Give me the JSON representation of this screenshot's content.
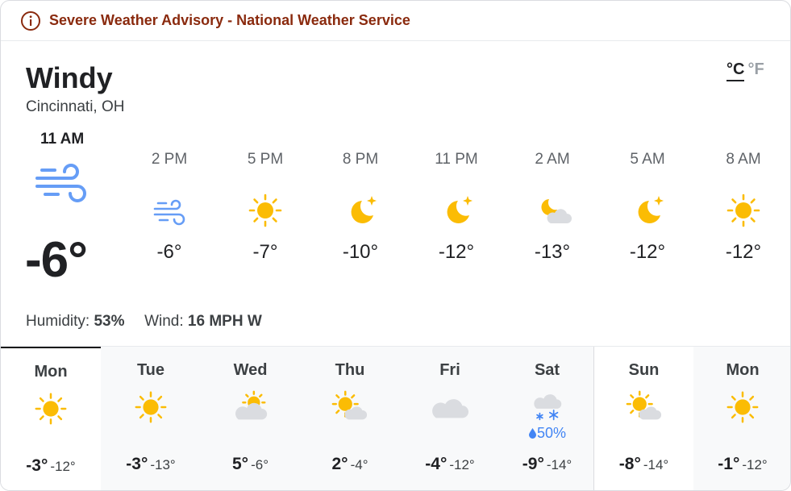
{
  "alert": {
    "icon": "info-icon",
    "text": "Severe Weather Advisory - National Weather Service",
    "color": "#8a2a0e"
  },
  "current": {
    "condition": "Windy",
    "location": "Cincinnati, OH",
    "time": "11 AM",
    "icon": "wind-icon",
    "temp": "-6°",
    "humidity_label": "Humidity:",
    "humidity": "53%",
    "wind_label": "Wind:",
    "wind": "16 MPH W"
  },
  "units": {
    "celsius": "°C",
    "fahrenheit": "°F",
    "selected": "celsius"
  },
  "hourly": [
    {
      "time": "2 PM",
      "icon": "wind-icon",
      "temp": "-6°"
    },
    {
      "time": "5 PM",
      "icon": "sun-icon",
      "temp": "-7°"
    },
    {
      "time": "8 PM",
      "icon": "moon-icon",
      "temp": "-10°"
    },
    {
      "time": "11 PM",
      "icon": "moon-icon",
      "temp": "-12°"
    },
    {
      "time": "2 AM",
      "icon": "moon-cloud-icon",
      "temp": "-13°"
    },
    {
      "time": "5 AM",
      "icon": "moon-icon",
      "temp": "-12°"
    },
    {
      "time": "8 AM",
      "icon": "sun-icon",
      "temp": "-12°"
    }
  ],
  "daily": [
    {
      "day": "Mon",
      "icon": "sun-icon",
      "precip": "",
      "high": "-3°",
      "low": "-12°"
    },
    {
      "day": "Tue",
      "icon": "sun-icon",
      "precip": "",
      "high": "-3°",
      "low": "-13°"
    },
    {
      "day": "Wed",
      "icon": "cloud-sun-icon",
      "precip": "",
      "high": "5°",
      "low": "-6°"
    },
    {
      "day": "Thu",
      "icon": "sun-cloud-icon",
      "precip": "",
      "high": "2°",
      "low": "-4°"
    },
    {
      "day": "Fri",
      "icon": "cloud-icon",
      "precip": "",
      "high": "-4°",
      "low": "-12°"
    },
    {
      "day": "Sat",
      "icon": "snow-icon",
      "precip": "50%",
      "high": "-9°",
      "low": "-14°"
    },
    {
      "day": "Sun",
      "icon": "sun-cloud-icon",
      "precip": "",
      "high": "-8°",
      "low": "-14°"
    },
    {
      "day": "Mon",
      "icon": "sun-icon",
      "precip": "",
      "high": "-1°",
      "low": "-12°"
    }
  ],
  "colors": {
    "sun": "#fbbc04",
    "wind": "#669df6",
    "cloud": "#dadce0",
    "precip": "#4285f4",
    "alert": "#8a2a0e"
  }
}
